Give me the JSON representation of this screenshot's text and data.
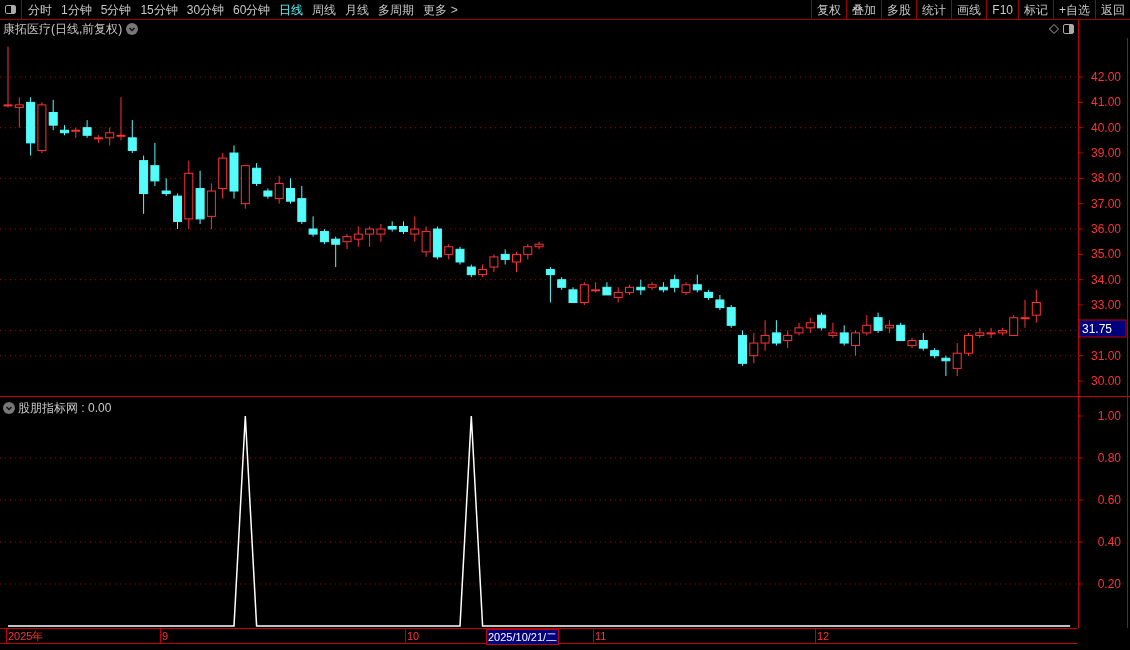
{
  "toolbar": {
    "periods": [
      {
        "label": "分时",
        "selected": false
      },
      {
        "label": "1分钟",
        "selected": false
      },
      {
        "label": "5分钟",
        "selected": false
      },
      {
        "label": "15分钟",
        "selected": false
      },
      {
        "label": "30分钟",
        "selected": false
      },
      {
        "label": "60分钟",
        "selected": false
      },
      {
        "label": "日线",
        "selected": true
      },
      {
        "label": "周线",
        "selected": false
      },
      {
        "label": "月线",
        "selected": false
      },
      {
        "label": "多周期",
        "selected": false
      },
      {
        "label": "更多 >",
        "selected": false
      }
    ],
    "buttons": [
      "复权",
      "叠加",
      "多股",
      "统计",
      "画线",
      "F10",
      "标记",
      "+自选",
      "返回"
    ]
  },
  "price_pane": {
    "title": "康拓医疗(日线,前复权)",
    "current_price": "31.75",
    "chart_data": {
      "type": "candlestick",
      "ylim": [
        29.41,
        44.25
      ],
      "grid": true,
      "yticks": [
        {
          "value": 42,
          "label": "42.00"
        },
        {
          "value": 41,
          "label": "41.00"
        },
        {
          "value": 40,
          "label": "40.00"
        },
        {
          "value": 39,
          "label": "39.00"
        },
        {
          "value": 38,
          "label": "38.00"
        },
        {
          "value": 37,
          "label": "37.00"
        },
        {
          "value": 36,
          "label": "36.00"
        },
        {
          "value": 35,
          "label": "35.00"
        },
        {
          "value": 34,
          "label": "34.00"
        },
        {
          "value": 33,
          "label": "33.00"
        },
        {
          "value": 31,
          "label": "31.00"
        },
        {
          "value": 30,
          "label": "30.00"
        }
      ],
      "ohlc": [
        [
          40.9,
          43.2,
          40.8,
          40.9
        ],
        [
          40.8,
          41.2,
          40.0,
          40.9
        ],
        [
          41.0,
          41.2,
          38.9,
          39.4
        ],
        [
          39.1,
          41.0,
          39.0,
          40.9
        ],
        [
          40.6,
          41.1,
          39.9,
          40.1
        ],
        [
          39.9,
          40.1,
          39.7,
          39.8
        ],
        [
          39.9,
          40.0,
          39.6,
          39.9
        ],
        [
          40.0,
          40.3,
          39.6,
          39.7
        ],
        [
          39.6,
          39.7,
          39.4,
          39.6
        ],
        [
          39.6,
          40.0,
          39.3,
          39.8
        ],
        [
          39.7,
          41.2,
          39.5,
          39.7
        ],
        [
          39.6,
          40.3,
          39.0,
          39.1
        ],
        [
          38.7,
          38.9,
          36.6,
          37.4
        ],
        [
          38.5,
          39.4,
          37.7,
          37.9
        ],
        [
          37.5,
          38.0,
          37.3,
          37.4
        ],
        [
          37.3,
          37.4,
          36.0,
          36.3
        ],
        [
          36.4,
          38.7,
          36.0,
          38.2
        ],
        [
          37.6,
          38.3,
          36.2,
          36.4
        ],
        [
          36.5,
          37.8,
          36.0,
          37.5
        ],
        [
          37.6,
          39.0,
          37.2,
          38.8
        ],
        [
          39.0,
          39.3,
          37.2,
          37.5
        ],
        [
          37.0,
          38.5,
          36.8,
          38.5
        ],
        [
          38.4,
          38.6,
          37.7,
          37.8
        ],
        [
          37.5,
          37.6,
          37.2,
          37.3
        ],
        [
          37.2,
          38.1,
          37.0,
          37.8
        ],
        [
          37.6,
          38.0,
          37.0,
          37.1
        ],
        [
          37.2,
          37.7,
          36.2,
          36.3
        ],
        [
          36.0,
          36.5,
          35.7,
          35.8
        ],
        [
          35.9,
          36.0,
          35.4,
          35.5
        ],
        [
          35.6,
          35.7,
          34.5,
          35.4
        ],
        [
          35.5,
          35.8,
          35.2,
          35.7
        ],
        [
          35.6,
          36.1,
          35.3,
          35.8
        ],
        [
          35.8,
          36.1,
          35.3,
          36.0
        ],
        [
          35.8,
          36.2,
          35.5,
          36.0
        ],
        [
          36.1,
          36.3,
          35.9,
          36.0
        ],
        [
          36.1,
          36.3,
          35.8,
          35.9
        ],
        [
          35.8,
          36.5,
          35.5,
          36.0
        ],
        [
          35.1,
          36.1,
          34.9,
          35.9
        ],
        [
          36.0,
          36.1,
          34.8,
          34.9
        ],
        [
          35.0,
          35.4,
          34.8,
          35.3
        ],
        [
          35.2,
          35.3,
          34.6,
          34.7
        ],
        [
          34.5,
          34.6,
          34.1,
          34.2
        ],
        [
          34.2,
          34.6,
          34.1,
          34.4
        ],
        [
          34.5,
          35.0,
          34.3,
          34.9
        ],
        [
          35.0,
          35.2,
          34.6,
          34.8
        ],
        [
          34.7,
          35.1,
          34.3,
          35.0
        ],
        [
          35.0,
          35.4,
          34.8,
          35.3
        ],
        [
          35.3,
          35.5,
          35.2,
          35.4
        ],
        [
          34.4,
          34.5,
          33.1,
          34.2
        ],
        [
          34.0,
          34.1,
          33.6,
          33.7
        ],
        [
          33.6,
          33.7,
          33.1,
          33.1
        ],
        [
          33.1,
          33.9,
          33.0,
          33.8
        ],
        [
          33.6,
          33.9,
          33.5,
          33.6
        ],
        [
          33.7,
          33.9,
          33.4,
          33.4
        ],
        [
          33.3,
          33.7,
          33.1,
          33.5
        ],
        [
          33.5,
          33.8,
          33.4,
          33.7
        ],
        [
          33.7,
          34.0,
          33.4,
          33.6
        ],
        [
          33.7,
          33.9,
          33.6,
          33.8
        ],
        [
          33.7,
          33.9,
          33.5,
          33.6
        ],
        [
          34.0,
          34.2,
          33.5,
          33.7
        ],
        [
          33.5,
          33.9,
          33.4,
          33.8
        ],
        [
          33.8,
          34.2,
          33.5,
          33.6
        ],
        [
          33.5,
          33.6,
          33.2,
          33.3
        ],
        [
          33.2,
          33.4,
          32.8,
          32.9
        ],
        [
          32.9,
          33.0,
          32.1,
          32.2
        ],
        [
          31.8,
          32.0,
          30.6,
          30.7
        ],
        [
          31.0,
          31.9,
          30.7,
          31.5
        ],
        [
          31.5,
          32.4,
          31.2,
          31.8
        ],
        [
          31.9,
          32.4,
          31.4,
          31.5
        ],
        [
          31.6,
          32.0,
          31.3,
          31.8
        ],
        [
          31.9,
          32.3,
          31.8,
          32.1
        ],
        [
          32.1,
          32.5,
          31.9,
          32.3
        ],
        [
          32.6,
          32.7,
          32.0,
          32.1
        ],
        [
          31.8,
          32.3,
          31.7,
          31.9
        ],
        [
          31.9,
          32.2,
          31.4,
          31.5
        ],
        [
          31.4,
          32.0,
          31.0,
          31.9
        ],
        [
          31.9,
          32.6,
          31.8,
          32.2
        ],
        [
          32.5,
          32.7,
          31.9,
          32.0
        ],
        [
          32.1,
          32.4,
          31.9,
          32.2
        ],
        [
          32.2,
          32.3,
          31.6,
          31.6
        ],
        [
          31.4,
          31.7,
          31.3,
          31.6
        ],
        [
          31.6,
          31.9,
          31.2,
          31.3
        ],
        [
          31.2,
          31.3,
          30.9,
          31.0
        ],
        [
          30.9,
          31.0,
          30.2,
          30.8
        ],
        [
          30.5,
          31.5,
          30.2,
          31.1
        ],
        [
          31.1,
          31.9,
          31.0,
          31.8
        ],
        [
          31.8,
          32.1,
          31.7,
          31.9
        ],
        [
          31.9,
          32.1,
          31.7,
          31.9
        ],
        [
          31.9,
          32.1,
          31.8,
          32.0
        ],
        [
          31.8,
          32.6,
          31.8,
          32.5
        ],
        [
          32.5,
          33.2,
          32.1,
          32.5
        ],
        [
          32.6,
          33.6,
          32.3,
          33.1
        ]
      ]
    }
  },
  "indicator_pane": {
    "title": "股朋指标网 : 0.00",
    "chart_data": {
      "type": "line",
      "ylim": [
        0,
        1.0905
      ],
      "grid": true,
      "yticks": [
        {
          "value": 1,
          "label": "1.00"
        },
        {
          "value": 0.8,
          "label": "0.80"
        },
        {
          "value": 0.6,
          "label": "0.60"
        },
        {
          "value": 0.4,
          "label": "0.40"
        },
        {
          "value": 0.2,
          "label": "0.20"
        }
      ],
      "series": [
        {
          "color": "#ffffff",
          "values": [
            0,
            0,
            0,
            0,
            0,
            0,
            0,
            0,
            0,
            0,
            0,
            0,
            0,
            0,
            0,
            0,
            0,
            0,
            0,
            0,
            0,
            1,
            0,
            0,
            0,
            0,
            0,
            0,
            0,
            0,
            0,
            0,
            0,
            0,
            0,
            0,
            0,
            0,
            0,
            0,
            0,
            1,
            0,
            0,
            0,
            0,
            0,
            0,
            0,
            0,
            0,
            0,
            0,
            0,
            0,
            0,
            0,
            0,
            0,
            0,
            0,
            0,
            0,
            0,
            0,
            0,
            0,
            0,
            0,
            0,
            0,
            0,
            0,
            0,
            0,
            0,
            0,
            0,
            0,
            0,
            0,
            0,
            0,
            0,
            0,
            0,
            0,
            0,
            0,
            0,
            0,
            0,
            0,
            0,
            0
          ]
        }
      ]
    }
  },
  "date_axis": [
    {
      "label": "2025年",
      "kind": "month"
    },
    {
      "label": "9",
      "kind": "month"
    },
    {
      "label": "10",
      "kind": "month"
    },
    {
      "label": "2025/10/21/二",
      "kind": "cursor"
    },
    {
      "label": "11",
      "kind": "month"
    },
    {
      "label": "12",
      "kind": "month"
    }
  ]
}
